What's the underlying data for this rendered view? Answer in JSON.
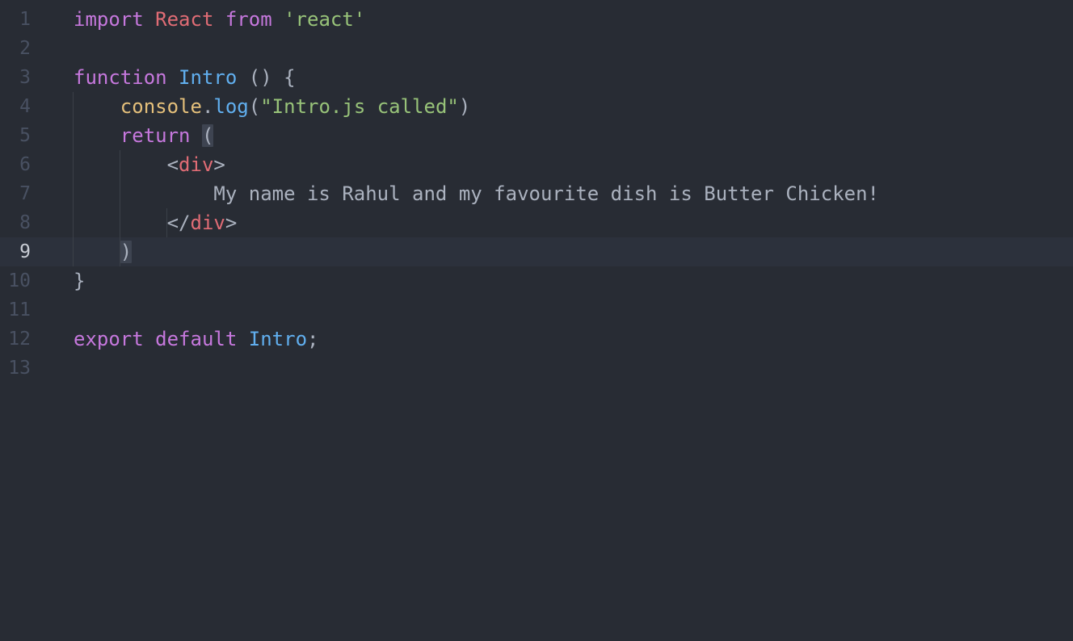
{
  "editor": {
    "active_line": "9",
    "lines": [
      {
        "number": "1",
        "tokens": [
          {
            "text": "import",
            "kind": "kw"
          },
          {
            "text": " ",
            "kind": "txt"
          },
          {
            "text": "React",
            "kind": "cls"
          },
          {
            "text": " ",
            "kind": "txt"
          },
          {
            "text": "from",
            "kind": "kw"
          },
          {
            "text": " ",
            "kind": "txt"
          },
          {
            "text": "'react'",
            "kind": "str"
          }
        ]
      },
      {
        "number": "2",
        "tokens": []
      },
      {
        "number": "3",
        "tokens": [
          {
            "text": "function",
            "kind": "kw"
          },
          {
            "text": " ",
            "kind": "txt"
          },
          {
            "text": "Intro",
            "kind": "fn"
          },
          {
            "text": " () {",
            "kind": "punc"
          }
        ]
      },
      {
        "number": "4",
        "tokens": [
          {
            "text": "    ",
            "kind": "txt"
          },
          {
            "text": "console",
            "kind": "obj"
          },
          {
            "text": ".",
            "kind": "punc"
          },
          {
            "text": "log",
            "kind": "fn"
          },
          {
            "text": "(",
            "kind": "punc"
          },
          {
            "text": "\"Intro.js called\"",
            "kind": "str"
          },
          {
            "text": ")",
            "kind": "punc"
          }
        ]
      },
      {
        "number": "5",
        "tokens": [
          {
            "text": "    ",
            "kind": "txt"
          },
          {
            "text": "return",
            "kind": "kw"
          },
          {
            "text": " ",
            "kind": "txt"
          },
          {
            "text": "(",
            "kind": "bracket-hl"
          }
        ]
      },
      {
        "number": "6",
        "tokens": [
          {
            "text": "        ",
            "kind": "txt"
          },
          {
            "text": "<",
            "kind": "punc"
          },
          {
            "text": "div",
            "kind": "tag"
          },
          {
            "text": ">",
            "kind": "punc"
          }
        ]
      },
      {
        "number": "7",
        "tokens": [
          {
            "text": "            ",
            "kind": "txt"
          },
          {
            "text": "My name is Rahul and my favourite dish is Butter Chicken!",
            "kind": "txt"
          }
        ]
      },
      {
        "number": "8",
        "tokens": [
          {
            "text": "        ",
            "kind": "txt"
          },
          {
            "text": "</",
            "kind": "punc"
          },
          {
            "text": "div",
            "kind": "tag"
          },
          {
            "text": ">",
            "kind": "punc"
          }
        ]
      },
      {
        "number": "9",
        "tokens": [
          {
            "text": "    ",
            "kind": "txt"
          },
          {
            "text": ")",
            "kind": "bracket-hl"
          }
        ]
      },
      {
        "number": "10",
        "tokens": [
          {
            "text": "}",
            "kind": "punc"
          }
        ]
      },
      {
        "number": "11",
        "tokens": []
      },
      {
        "number": "12",
        "tokens": [
          {
            "text": "export",
            "kind": "kw"
          },
          {
            "text": " ",
            "kind": "txt"
          },
          {
            "text": "default",
            "kind": "kw"
          },
          {
            "text": " ",
            "kind": "txt"
          },
          {
            "text": "Intro",
            "kind": "fn"
          },
          {
            "text": ";",
            "kind": "punc"
          }
        ]
      },
      {
        "number": "13",
        "tokens": []
      }
    ]
  }
}
